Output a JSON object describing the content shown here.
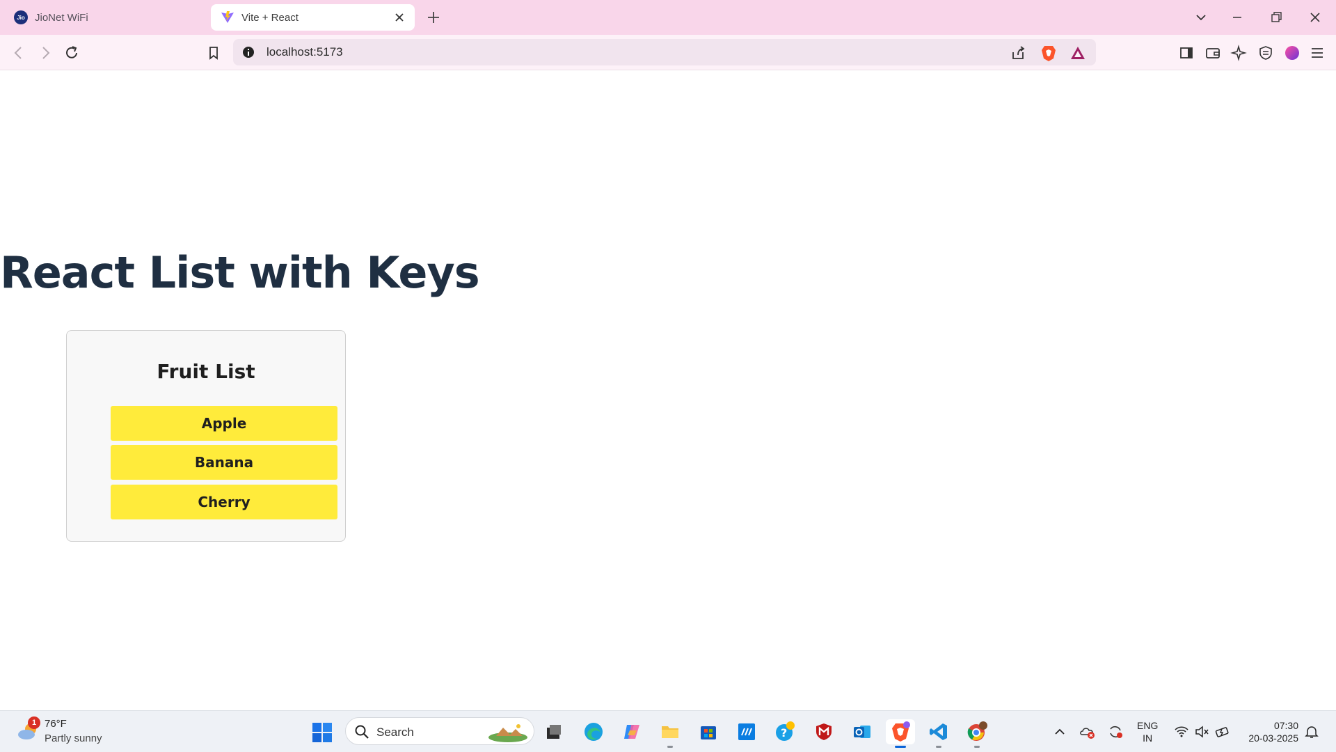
{
  "browser": {
    "tabs": [
      {
        "title": "JioNet WiFi",
        "active": false
      },
      {
        "title": "Vite + React",
        "active": true
      }
    ],
    "address": "localhost:5173",
    "theme_color": "#f9d6ea"
  },
  "page": {
    "title": "React List with Keys",
    "card_title": "Fruit List",
    "fruits": [
      "Apple",
      "Banana",
      "Cherry"
    ],
    "item_color": "#ffeb3b"
  },
  "taskbar": {
    "weather": {
      "badge": "1",
      "temp": "76°F",
      "desc": "Partly sunny"
    },
    "search_placeholder": "Search",
    "language": {
      "line1": "ENG",
      "line2": "IN"
    },
    "clock": {
      "time": "07:30",
      "date": "20-03-2025"
    }
  }
}
